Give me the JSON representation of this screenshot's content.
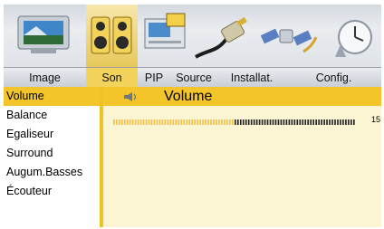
{
  "tabs": [
    "Image",
    "Son",
    "PIP",
    "Source",
    "Installat.",
    "Config."
  ],
  "selected_tab": "Son",
  "menu_items": [
    "Volume",
    "Balance",
    "Egaliseur",
    "Surround",
    "Augum.Basses",
    "Écouteur"
  ],
  "selected_item": "Volume",
  "panel": {
    "title": "Volume",
    "speaker_icon": "speaker-icon",
    "volume_value": "15",
    "volume_level": 0.5
  },
  "colors": {
    "highlight": "#f3c52a",
    "panel_bg": "#fbf5d3",
    "frame": "#000000"
  }
}
